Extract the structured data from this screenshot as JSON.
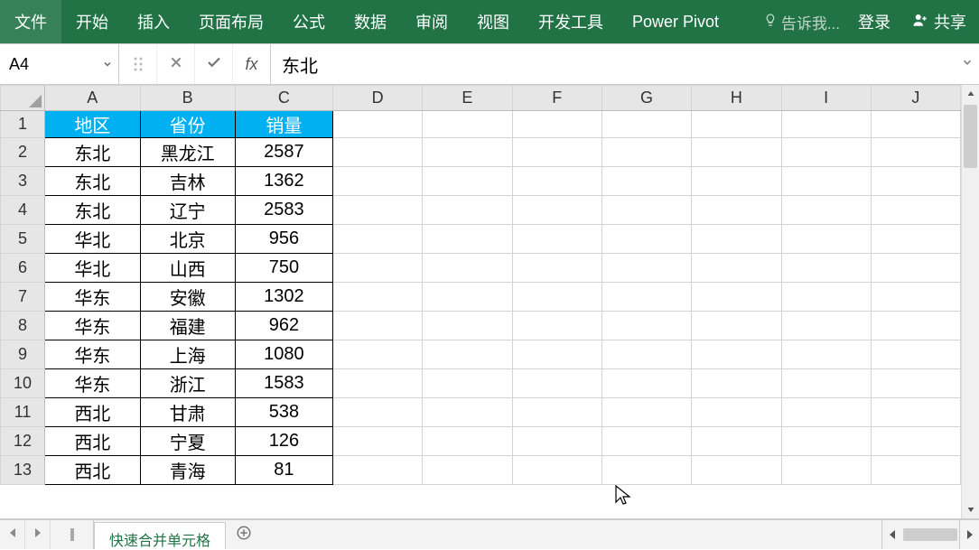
{
  "ribbon": {
    "tabs": [
      "文件",
      "开始",
      "插入",
      "页面布局",
      "公式",
      "数据",
      "审阅",
      "视图",
      "开发工具",
      "Power Pivot"
    ],
    "tell_me": "告诉我...",
    "login": "登录",
    "share": "共享"
  },
  "namebox": {
    "value": "A4"
  },
  "fx_label": "fx",
  "formula": {
    "value": "东北"
  },
  "columns": [
    "A",
    "B",
    "C",
    "D",
    "E",
    "F",
    "G",
    "H",
    "I",
    "J"
  ],
  "headers": {
    "region": "地区",
    "province": "省份",
    "sales": "销量"
  },
  "rows": [
    {
      "n": 1
    },
    {
      "n": 2,
      "region": "东北",
      "province": "黑龙江",
      "sales": "2587"
    },
    {
      "n": 3,
      "region": "东北",
      "province": "吉林",
      "sales": "1362"
    },
    {
      "n": 4,
      "region": "东北",
      "province": "辽宁",
      "sales": "2583"
    },
    {
      "n": 5,
      "region": "华北",
      "province": "北京",
      "sales": "956"
    },
    {
      "n": 6,
      "region": "华北",
      "province": "山西",
      "sales": "750"
    },
    {
      "n": 7,
      "region": "华东",
      "province": "安徽",
      "sales": "1302"
    },
    {
      "n": 8,
      "region": "华东",
      "province": "福建",
      "sales": "962"
    },
    {
      "n": 9,
      "region": "华东",
      "province": "上海",
      "sales": "1080"
    },
    {
      "n": 10,
      "region": "华东",
      "province": "浙江",
      "sales": "1583"
    },
    {
      "n": 11,
      "region": "西北",
      "province": "甘肃",
      "sales": "538"
    },
    {
      "n": 12,
      "region": "西北",
      "province": "宁夏",
      "sales": "126"
    },
    {
      "n": 13,
      "region": "西北",
      "province": "青海",
      "sales": "81"
    }
  ],
  "sheet_tab": "快速合并单元格",
  "chart_data": {
    "type": "table",
    "columns": [
      "地区",
      "省份",
      "销量"
    ],
    "rows": [
      [
        "东北",
        "黑龙江",
        2587
      ],
      [
        "东北",
        "吉林",
        1362
      ],
      [
        "东北",
        "辽宁",
        2583
      ],
      [
        "华北",
        "北京",
        956
      ],
      [
        "华北",
        "山西",
        750
      ],
      [
        "华东",
        "安徽",
        1302
      ],
      [
        "华东",
        "福建",
        962
      ],
      [
        "华东",
        "上海",
        1080
      ],
      [
        "华东",
        "浙江",
        1583
      ],
      [
        "西北",
        "甘肃",
        538
      ],
      [
        "西北",
        "宁夏",
        126
      ],
      [
        "西北",
        "青海",
        81
      ]
    ]
  }
}
